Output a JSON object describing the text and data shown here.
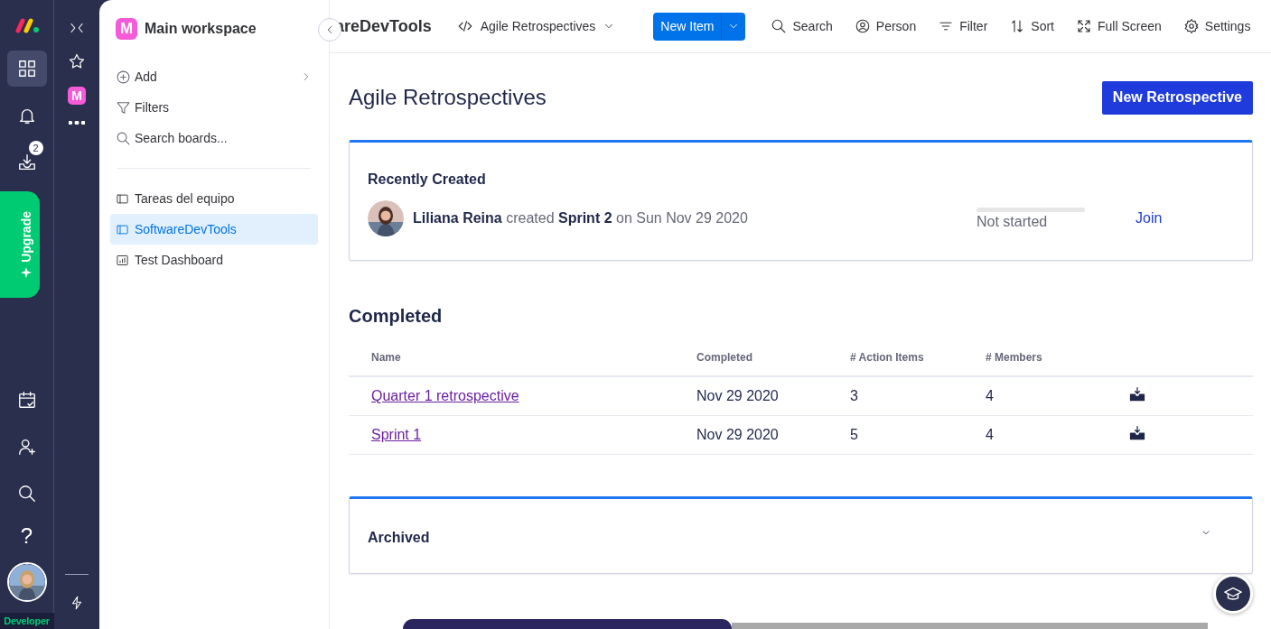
{
  "rail": {
    "badge": "2",
    "upgrade": "Upgrade",
    "plan": "Developer",
    "items": [
      {
        "kind": "apps",
        "selected": true
      },
      {
        "kind": "bell",
        "selected": false
      },
      {
        "kind": "inbox",
        "selected": false
      }
    ],
    "bottom_items": [
      {
        "kind": "calendar"
      },
      {
        "kind": "add-person"
      },
      {
        "kind": "search"
      },
      {
        "kind": "help",
        "label": "?"
      }
    ]
  },
  "workspace_rail": {
    "logo": "M"
  },
  "sidebar": {
    "workspace_logo": "M",
    "workspace": "Main workspace",
    "actions": [
      {
        "kind": "add",
        "label": "Add"
      },
      {
        "kind": "filter",
        "label": "Filters"
      },
      {
        "kind": "search",
        "label": "Search boards..."
      }
    ],
    "boards": [
      {
        "kind": "board",
        "label": "Tareas del equipo",
        "selected": false
      },
      {
        "kind": "board",
        "label": "SoftwareDevTools",
        "selected": true
      },
      {
        "kind": "dashboard",
        "label": "Test Dashboard",
        "selected": false
      }
    ]
  },
  "topbar": {
    "board": "areDevTools",
    "view": "Agile Retrospectives",
    "new_item": "New Item",
    "tools": [
      {
        "kind": "search",
        "label": "Search"
      },
      {
        "kind": "person",
        "label": "Person"
      },
      {
        "kind": "filter",
        "label": "Filter"
      },
      {
        "kind": "sort",
        "label": "Sort"
      },
      {
        "kind": "fullscreen",
        "label": "Full Screen"
      },
      {
        "kind": "settings",
        "label": "Settings"
      }
    ]
  },
  "page": {
    "title": "Agile Retrospectives",
    "new_button": "New Retrospective"
  },
  "recent": {
    "title": "Recently Created",
    "user": "Liliana Reina",
    "verb": "created",
    "item": "Sprint 2",
    "date": "on Sun Nov 29 2020",
    "level": 0,
    "status": "Not started",
    "join": "Join"
  },
  "completed": {
    "title": "Completed",
    "columns": [
      "Name",
      "Completed",
      "# Action Items",
      "# Members"
    ],
    "rows": [
      {
        "name": "Quarter 1 retrospective",
        "completed": "Nov 29 2020",
        "actions": "3",
        "members": "4"
      },
      {
        "name": "Sprint 1",
        "completed": "Nov 29 2020",
        "actions": "5",
        "members": "4"
      }
    ]
  },
  "archived": {
    "title": "Archived",
    "expanded": false
  }
}
